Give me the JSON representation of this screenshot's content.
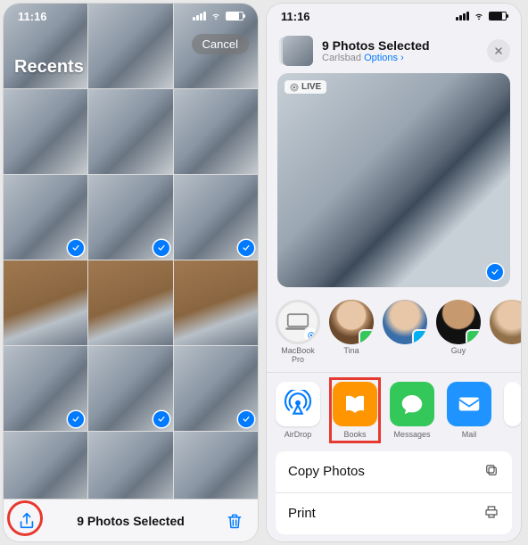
{
  "status": {
    "time": "11:16"
  },
  "left": {
    "album_title": "Recents",
    "cancel_label": "Cancel",
    "selection_label": "9 Photos Selected",
    "thumbs": [
      {
        "selected": false,
        "wood": false
      },
      {
        "selected": false,
        "wood": false
      },
      {
        "selected": false,
        "wood": false
      },
      {
        "selected": false,
        "wood": false
      },
      {
        "selected": false,
        "wood": false
      },
      {
        "selected": false,
        "wood": false
      },
      {
        "selected": true,
        "wood": false
      },
      {
        "selected": true,
        "wood": false
      },
      {
        "selected": true,
        "wood": false
      },
      {
        "selected": false,
        "wood": true
      },
      {
        "selected": false,
        "wood": true
      },
      {
        "selected": false,
        "wood": true
      },
      {
        "selected": true,
        "wood": false
      },
      {
        "selected": true,
        "wood": false
      },
      {
        "selected": true,
        "wood": false
      },
      {
        "selected": false,
        "wood": false
      },
      {
        "selected": false,
        "wood": false
      },
      {
        "selected": false,
        "wood": false
      }
    ]
  },
  "right": {
    "header_title": "9 Photos Selected",
    "header_location": "Carlsbad",
    "header_options": "Options",
    "live_badge": "LIVE",
    "contacts": [
      {
        "name": "MacBook Pro",
        "type": "mac"
      },
      {
        "name": "Tina",
        "badge": "msg"
      },
      {
        "name": "",
        "badge": "skype"
      },
      {
        "name": "Guy",
        "badge": "msg"
      },
      {
        "name": "",
        "badge": ""
      }
    ],
    "apps": {
      "airdrop": "AirDrop",
      "books": "Books",
      "messages": "Messages",
      "mail": "Mail"
    },
    "actions": {
      "copy": "Copy Photos",
      "print": "Print"
    }
  }
}
